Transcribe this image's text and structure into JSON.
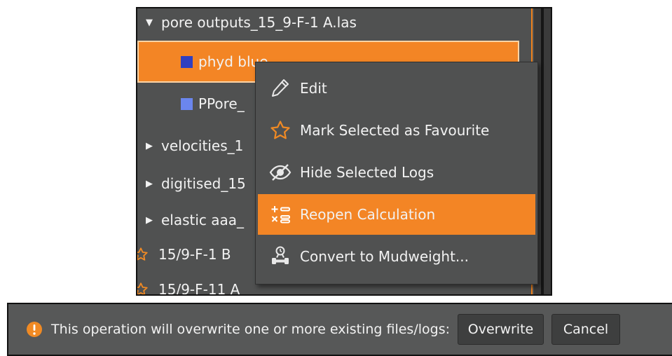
{
  "tree": {
    "items": [
      {
        "label": "pore outputs_15_9-F-1 A.las",
        "icon": "caret-down-icon"
      },
      {
        "label": "phyd blue",
        "icon": "swatch-icon",
        "color": "#3040c0",
        "selected": true
      },
      {
        "label": "PPore_",
        "icon": "swatch-icon",
        "color": "#6b86ee"
      },
      {
        "label": "velocities_1",
        "icon": "caret-right-icon"
      },
      {
        "label": "digitised_15",
        "icon": "caret-right-icon"
      },
      {
        "label": "elastic aaa_",
        "icon": "caret-right-icon"
      },
      {
        "label": "15/9-F-1 B",
        "icon": "star-outline-icon"
      },
      {
        "label": "15/9-F-11 A",
        "icon": "star-outline-icon"
      }
    ]
  },
  "context_menu": {
    "items": [
      {
        "label": "Edit",
        "icon": "pencil-icon"
      },
      {
        "label": "Mark Selected as Favourite",
        "icon": "star-outline-icon"
      },
      {
        "label": "Hide Selected Logs",
        "icon": "eye-hidden-icon"
      },
      {
        "label": "Reopen Calculation",
        "icon": "calculator-icon",
        "active": true
      },
      {
        "label": "Convert to Mudweight...",
        "icon": "mudweight-icon"
      }
    ]
  },
  "warning": {
    "message": "This operation will overwrite one or more existing files/logs:",
    "icon": "warning-circle-icon",
    "overwrite_label": "Overwrite",
    "cancel_label": "Cancel"
  },
  "colors": {
    "accent": "#f38525",
    "panel": "#505151",
    "star": "#f08a24"
  }
}
